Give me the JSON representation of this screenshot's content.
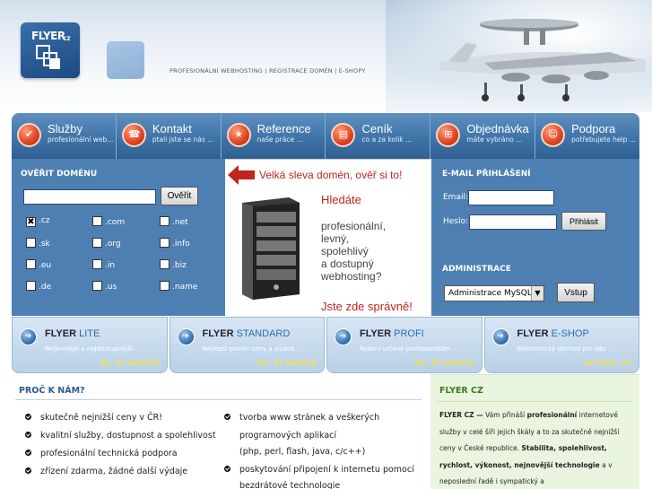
{
  "header": {
    "logo_text": "FLYER",
    "logo_sub": "CZ",
    "tagline": "PROFESIONÁLNÍ WEBHOSTING | REGISTRACE DOMÉN | E-SHOPY"
  },
  "nav": [
    {
      "title": "Služby",
      "subtitle": "profesionální web...",
      "icon": "check-icon"
    },
    {
      "title": "Kontakt",
      "subtitle": "ptali jste se nás ...",
      "icon": "phone-icon"
    },
    {
      "title": "Reference",
      "subtitle": "naše práce ...",
      "icon": "star-icon"
    },
    {
      "title": "Ceník",
      "subtitle": "co a za kolik ...",
      "icon": "price-list-icon"
    },
    {
      "title": "Objednávka",
      "subtitle": "máte vybráno ...",
      "icon": "cart-icon"
    },
    {
      "title": "Podpora",
      "subtitle": "potřebujete help ...",
      "icon": "support-icon"
    }
  ],
  "domain_check": {
    "title": "OVĚŘIT DOMÉNU",
    "input_value": "",
    "button_label": "Ověřit",
    "tlds": [
      {
        "label": ".cz",
        "checked": true
      },
      {
        "label": ".com",
        "checked": false
      },
      {
        "label": ".net",
        "checked": false
      },
      {
        "label": ".sk",
        "checked": false
      },
      {
        "label": ".org",
        "checked": false
      },
      {
        "label": ".info",
        "checked": false
      },
      {
        "label": ".eu",
        "checked": false
      },
      {
        "label": ".in",
        "checked": false
      },
      {
        "label": ".biz",
        "checked": false
      },
      {
        "label": ".de",
        "checked": false
      },
      {
        "label": ".us",
        "checked": false
      },
      {
        "label": ".name",
        "checked": false
      }
    ]
  },
  "banner": {
    "headline": "Velká sleva domén, ověř si to!",
    "question": "Hledáte",
    "lines": [
      "profesionální,",
      "levný,",
      "spolehlivý",
      "a dostupný",
      "webhosting?"
    ],
    "cta": "Jste zde správně!"
  },
  "login": {
    "title": "E-MAIL PŘIHLÁŠENÍ",
    "email_label": "Email:",
    "password_label": "Heslo:",
    "button_label": "Přihlásit",
    "admin_title": "ADMINISTRACE",
    "admin_selected": "Administrace MySQL",
    "admin_button": "Vstup"
  },
  "packages": [
    {
      "prefix": "FLYER",
      "name": "LITE",
      "desc": "Nejlevnější a nejdostupnější ...",
      "price": "29,- Kč měsíčně"
    },
    {
      "prefix": "FLYER",
      "name": "STANDARD",
      "desc": "Nejlepší poměr ceny a služeb ...",
      "price": "59,- Kč měsíčně"
    },
    {
      "prefix": "FLYER",
      "name": "PROFI",
      "desc": "Řešení určené profesionálům ...",
      "price": "99,- Kč měsíčně"
    },
    {
      "prefix": "FLYER",
      "name": "E-SHOP",
      "desc": "Elektronický obchod pro Vás ...",
      "price": "od 1428,- Kč"
    }
  ],
  "why": {
    "title": "PROČ K NÁM?",
    "left_items": [
      "skutečně nejnižší ceny v ČR!",
      "kvalitní služby, dostupnost a spolehlivost",
      "profesionální technická podpora",
      "zřízení zdarma, žádné další výdaje"
    ],
    "right_items": [
      {
        "text": "tvorba www stránek a veškerých",
        "sub": [
          "programových aplikací",
          "(php, perl, flash, java, c/c++)"
        ]
      },
      {
        "text": "poskytování připojení k internetu pomocí",
        "sub": [
          "bezdrátové technologie"
        ]
      }
    ]
  },
  "flyer_box": {
    "title": "FLYER CZ",
    "lead": "FLYER CZ —",
    "text1": " Vám přináší ",
    "bold1": "profesionální",
    "text2": " internetové služby v celé šíři jejich škály a to za skutečně nejnižší ceny v České republice. ",
    "bold2": "Stabilita, spolehlivost, rychlost, výkonost, nejnovější technologie",
    "text3": " a v neposlední řadě i sympatický a"
  }
}
